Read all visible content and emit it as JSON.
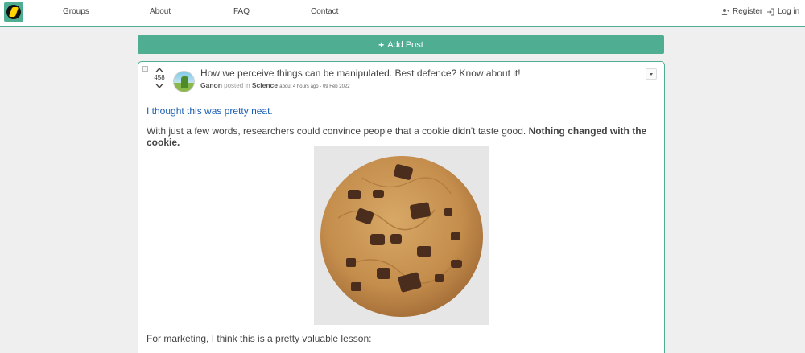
{
  "nav": {
    "links": [
      "Groups",
      "About",
      "FAQ",
      "Contact"
    ],
    "register": "Register",
    "login": "Log in"
  },
  "add_post": {
    "label": "Add Post"
  },
  "post": {
    "score": "458",
    "title": "How we perceive things can be manipulated. Best defence? Know about it!",
    "author": "Ganon",
    "posted_in": "posted in",
    "group": "Science",
    "time": "about 4 hours ago - 09 Feb 2022",
    "body": {
      "intro": "I thought this was pretty neat.",
      "sentence": "With just a few words, researchers could convince people that a cookie didn't taste good.",
      "sentence_bold": "Nothing changed with the cookie.",
      "closing": "For marketing, I think this is a pretty valuable lesson:"
    }
  },
  "colors": {
    "accent": "#4fae92",
    "link": "#1a5fb4"
  }
}
